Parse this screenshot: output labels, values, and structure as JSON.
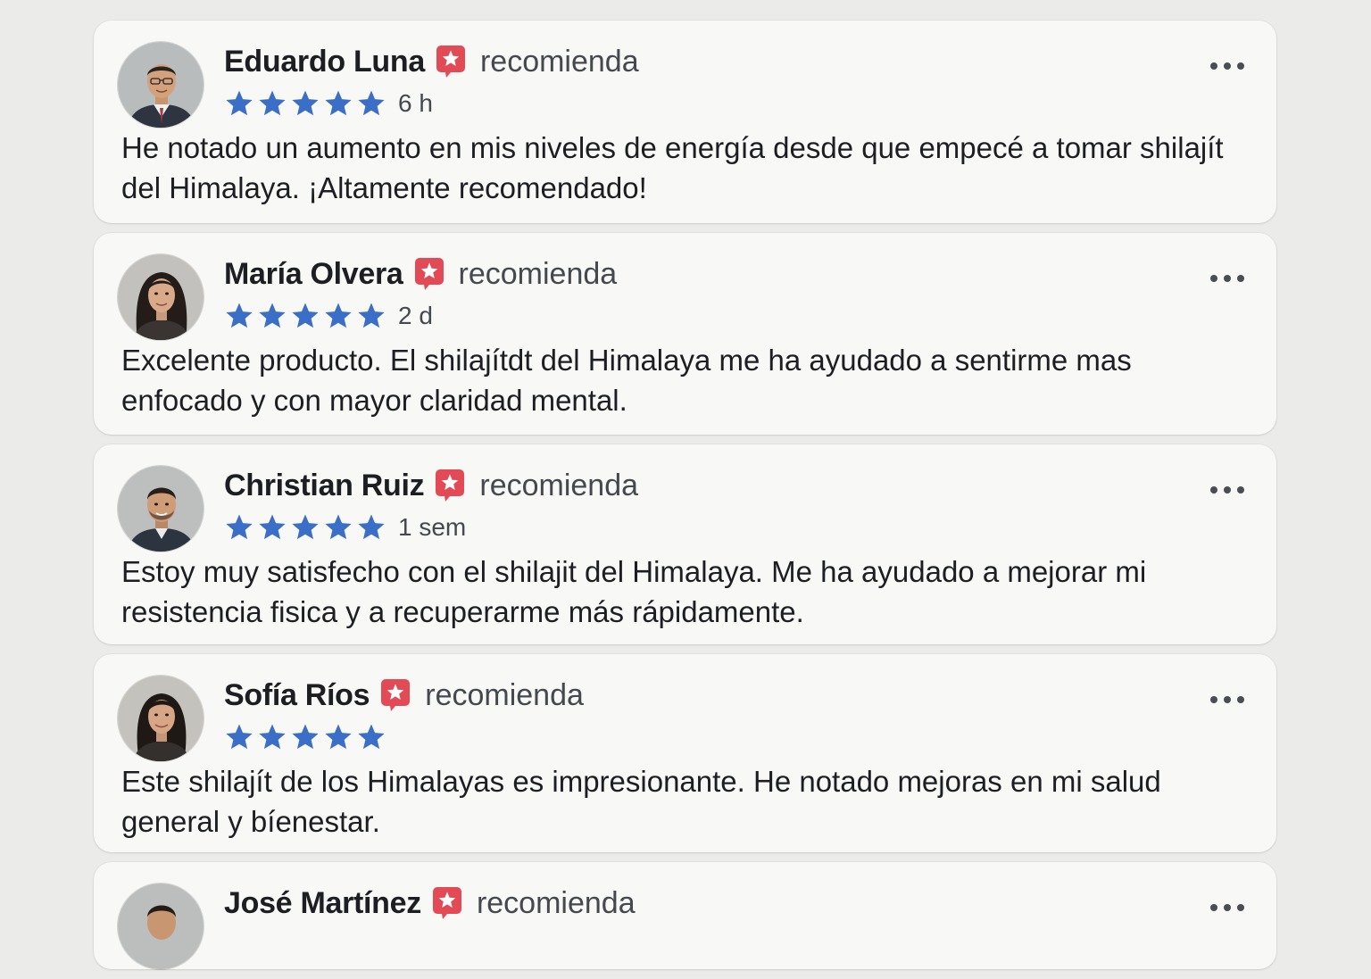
{
  "colors": {
    "background": "#ebebea",
    "card": "#f8f8f7",
    "star": "#3b6fc7",
    "badge": "#e24a55"
  },
  "icons": {
    "badge": "recommend-badge-icon",
    "star": "star-icon",
    "more": "more-options-icon"
  },
  "reviews": [
    {
      "name": "Eduardo Luna",
      "action": "recomienda",
      "rating": 5,
      "time": "6 h",
      "text": "He notado un aumento en mis niveles de energía desde que empecé a tomar shilajít del Himalaya. ¡Altamente recomendado!"
    },
    {
      "name": "María Olvera",
      "action": "recomienda",
      "rating": 5,
      "time": "2 d",
      "text": "Excelente producto. El shilajítdt del Himalaya me ha ayudado a sentirme mas enfocado y con mayor claridad mental."
    },
    {
      "name": "Christian Ruiz",
      "action": "recomienda",
      "rating": 5,
      "time": "1 sem",
      "text": "Estoy muy satisfecho con el shilajit del Himalaya. Me ha ayudado a mejorar mi resistencia fisica y a recuperarme más rápidamente."
    },
    {
      "name": "Sofía Ríos",
      "action": "recomienda",
      "rating": 5,
      "time": "",
      "text": "Este shilajít de  los  Himalayas es impresionante. He notado mejoras en mi salud general y bíenestar."
    },
    {
      "name": "José Martínez",
      "action": "recomienda"
    }
  ]
}
